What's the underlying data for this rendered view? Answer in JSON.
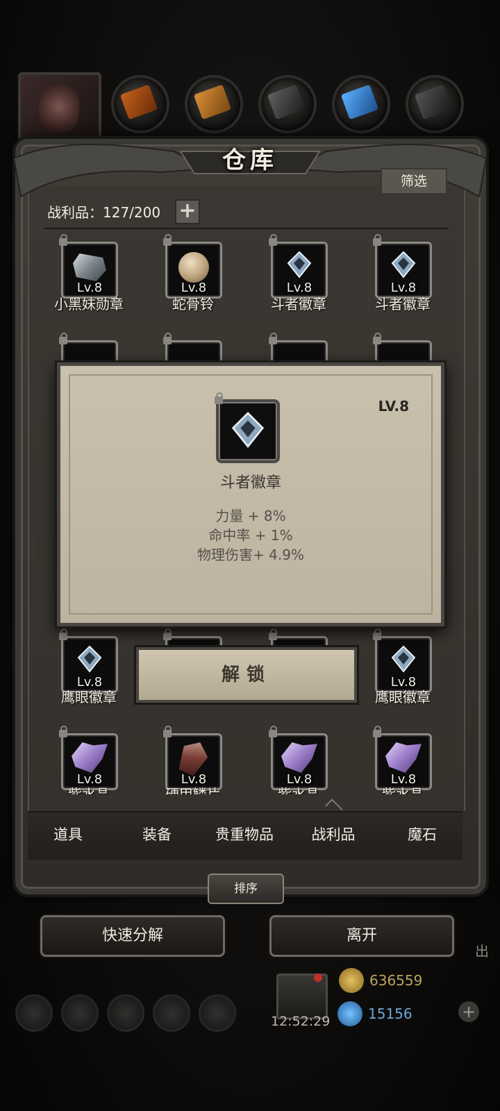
{
  "header": {
    "title": "仓库",
    "filter_label": "筛选"
  },
  "capacity": {
    "label": "战利品：127/200",
    "plus": "+"
  },
  "items": [
    {
      "name": "小黑妹勋章",
      "level": "Lv.8",
      "icon": "gem-shard-icon"
    },
    {
      "name": "蛇骨铃",
      "level": "Lv.8",
      "icon": "bone-bell-icon"
    },
    {
      "name": "斗者徽章",
      "level": "Lv.8",
      "icon": "badge-icon"
    },
    {
      "name": "斗者徽章",
      "level": "Lv.8",
      "icon": "badge-icon"
    },
    {
      "name": "鹰眼徽章",
      "level": "Lv.8",
      "icon": "badge-icon"
    },
    {
      "name": "鹰眼徽章",
      "level": "Lv.8",
      "icon": "badge-icon"
    },
    {
      "name": "紫水晶",
      "level": "Lv.8",
      "icon": "crystal-icon"
    },
    {
      "name": "硬甲鳞片",
      "level": "Lv.8",
      "icon": "scale-icon"
    },
    {
      "name": "紫水晶",
      "level": "Lv.8",
      "icon": "crystal-icon"
    },
    {
      "name": "紫水晶",
      "level": "Lv.8",
      "icon": "crystal-icon"
    }
  ],
  "popup": {
    "level": "LV.8",
    "name": "斗者徽章",
    "stats": [
      "力量 + 8%",
      "命中率 + 1%",
      "物理伤害+ 4.9%"
    ],
    "unlock_label": "解锁"
  },
  "tabs": [
    "道具",
    "装备",
    "贵重物品",
    "战利品",
    "魔石"
  ],
  "active_tab": "战利品",
  "sort_label": "排序",
  "actions": {
    "quick_decompose": "快速分解",
    "leave": "离开"
  },
  "hud": {
    "time": "12:52:29",
    "gold": "636559",
    "gems": "15156",
    "side_text": "出"
  },
  "colors": {
    "frame": "#3a3936",
    "popup_bg": "#c9c0ad",
    "gold_text": "#bba55c",
    "gem_text": "#6fa7d8"
  }
}
